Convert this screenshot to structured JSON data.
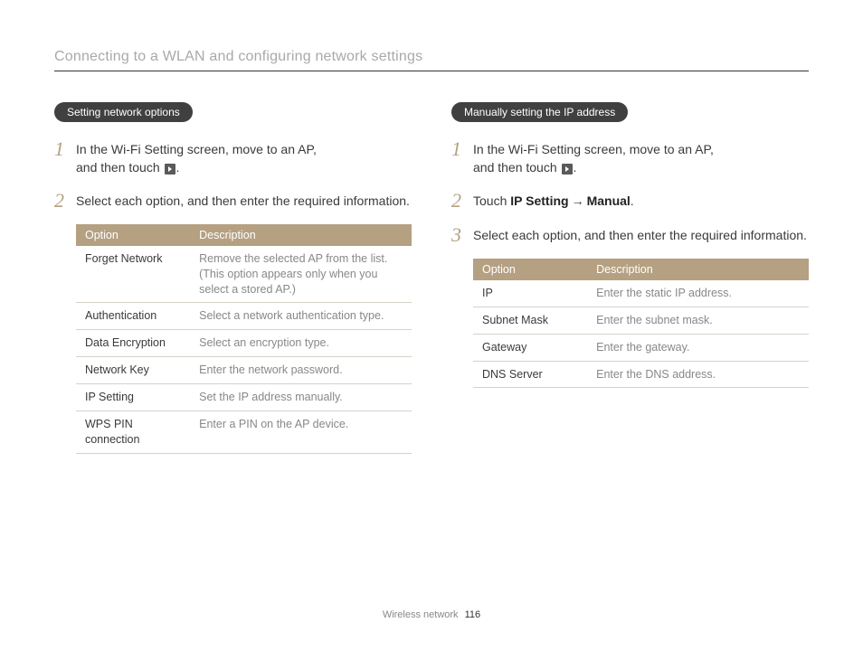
{
  "header": {
    "title": "Connecting to a WLAN and configuring network settings"
  },
  "left": {
    "pill": "Setting network options",
    "step1a": "In the Wi-Fi Setting screen, move to an AP,",
    "step1b_pre": "and then touch ",
    "step1b_post": ".",
    "step2": "Select each option, and then enter the required information.",
    "table": {
      "h_option": "Option",
      "h_desc": "Description",
      "rows": [
        {
          "opt": "Forget Network",
          "desc": "Remove the selected AP from the list. (This option appears only when you select a stored AP.)"
        },
        {
          "opt": "Authentication",
          "desc": "Select a network authentication type."
        },
        {
          "opt": "Data Encryption",
          "desc": "Select an encryption type."
        },
        {
          "opt": "Network Key",
          "desc": "Enter the network password."
        },
        {
          "opt": "IP Setting",
          "desc": "Set the IP address manually."
        },
        {
          "opt": "WPS PIN connection",
          "desc": "Enter a PIN on the AP device."
        }
      ]
    }
  },
  "right": {
    "pill": "Manually setting the IP address",
    "step1a": "In the Wi-Fi Setting screen, move to an AP,",
    "step1b_pre": "and then touch ",
    "step1b_post": ".",
    "step2_pre": "Touch ",
    "step2_ip": "IP Setting",
    "step2_arrow": "→",
    "step2_manual": "Manual",
    "step2_post": ".",
    "step3": "Select each option, and then enter the required information.",
    "table": {
      "h_option": "Option",
      "h_desc": "Description",
      "rows": [
        {
          "opt": "IP",
          "desc": "Enter the static IP address."
        },
        {
          "opt": "Subnet Mask",
          "desc": "Enter the subnet mask."
        },
        {
          "opt": "Gateway",
          "desc": "Enter the gateway."
        },
        {
          "opt": "DNS Server",
          "desc": "Enter the DNS address."
        }
      ]
    }
  },
  "footer": {
    "section": "Wireless network",
    "page": "116"
  }
}
